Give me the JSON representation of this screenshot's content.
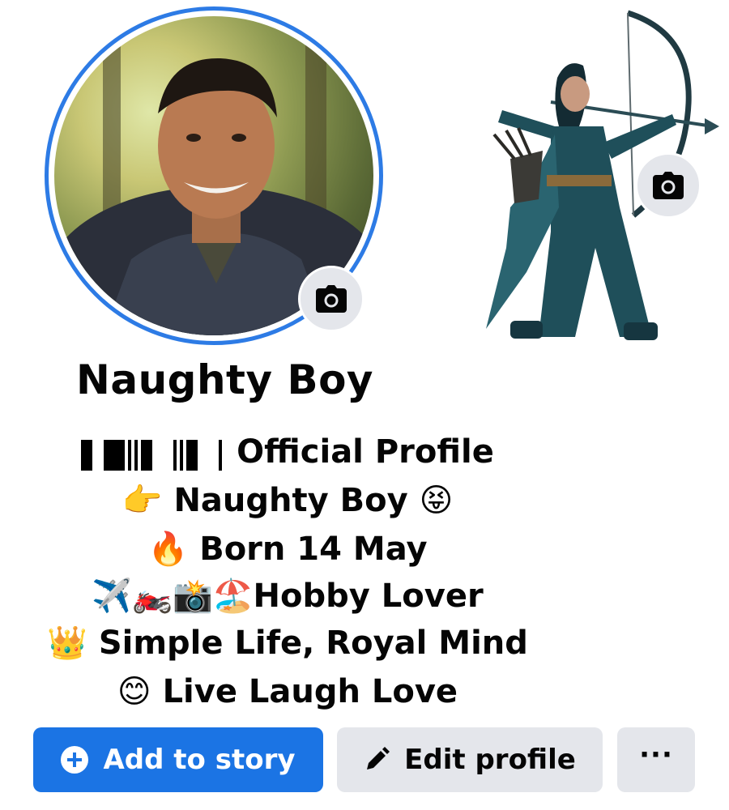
{
  "profile": {
    "name": "Naughty Boy",
    "bio": [
      {
        "icon": "barcode-glyph",
        "text": "Official Profile"
      },
      {
        "icon": "pointing-hand-emoji",
        "prefix": "👉",
        "text": "Naughty Boy",
        "suffix": "😝"
      },
      {
        "icon": "fire-emoji",
        "prefix": "🔥",
        "text": "Born 14 May"
      },
      {
        "icon": "hobby-emojis",
        "prefix": "✈️🏍️📸🏖️",
        "text": "Hobby Lover"
      },
      {
        "icon": "crown-emoji",
        "prefix": "👑",
        "text": "Simple Life, Royal Mind"
      },
      {
        "icon": "smile-emoji",
        "prefix": "😊",
        "text": "Live Laugh Love"
      }
    ]
  },
  "actions": {
    "add_story_label": "Add to story",
    "edit_profile_label": "Edit profile",
    "more_label": "···"
  },
  "colors": {
    "accent": "#1b74e4",
    "ring": "#2d7be5",
    "secondary_button": "#e4e6eb"
  }
}
